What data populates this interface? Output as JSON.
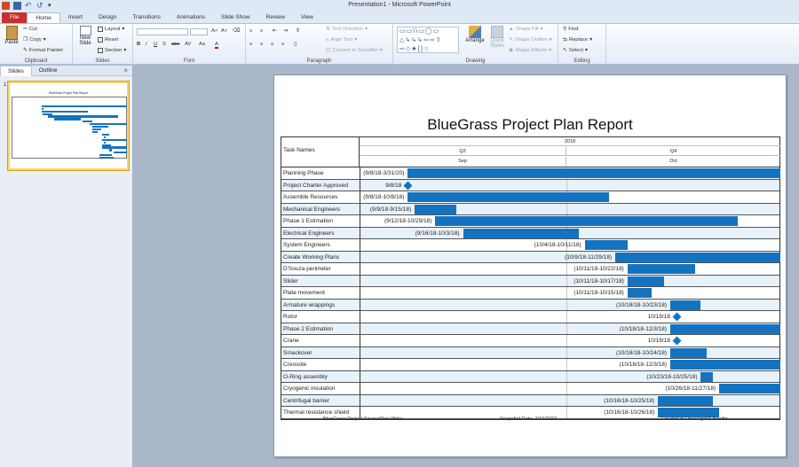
{
  "window": {
    "title": "Presentation1 - Microsoft PowerPoint"
  },
  "tabs": [
    "File",
    "Home",
    "Insert",
    "Design",
    "Transitions",
    "Animations",
    "Slide Show",
    "Review",
    "View"
  ],
  "ribbon": {
    "clipboard": {
      "label": "Clipboard",
      "paste": "Paste",
      "cut": "Cut",
      "copy": "Copy",
      "format_painter": "Format Painter"
    },
    "slides": {
      "label": "Slides",
      "new_slide": "New Slide",
      "layout": "Layout",
      "reset": "Reset",
      "section": "Section"
    },
    "font": {
      "label": "Font"
    },
    "paragraph": {
      "label": "Paragraph",
      "text_direction": "Text Direction",
      "align_text": "Align Text",
      "convert_smartart": "Convert to SmartArt"
    },
    "drawing": {
      "label": "Drawing",
      "arrange": "Arrange",
      "quick_styles": "Quick Styles",
      "shape_fill": "Shape Fill",
      "shape_outline": "Shape Outline",
      "shape_effects": "Shape Effects"
    },
    "editing": {
      "label": "Editing",
      "find": "Find",
      "replace": "Replace",
      "select": "Select"
    }
  },
  "left_panel": {
    "tab_slides": "Slides",
    "tab_outline": "Outline",
    "slide_number": "1"
  },
  "slide": {
    "title": "BlueGrass Project Plan Report",
    "header": {
      "task_names": "Task Names",
      "year": "2018",
      "q3": "Q3",
      "q4": "Q4",
      "sep": "Sep",
      "oct": "Oct"
    },
    "footer": {
      "left": "BlueGrass Project SourcePlan-Wrike",
      "center": "Snapshot Date: 2/10/2023",
      "right": "Created in OnePager® Bundle"
    }
  },
  "colors": {
    "bar": "#1473c0",
    "row_alt": "#e8f2fa",
    "file_tab": "#c9302c",
    "thumb_border": "#f7d66a"
  },
  "chart_data": {
    "type": "gantt",
    "timeline": {
      "start": "2018-09-01",
      "end": "2018-11-05",
      "quarter_boundary": "2018-10-01"
    },
    "tasks": [
      {
        "name": "Planning Phase",
        "label": "(9/8/18-3/31/20)",
        "start": "2018-09-08",
        "end": "2020-03-31",
        "milestone": false
      },
      {
        "name": "Project Charter Approved",
        "label": "9/8/18",
        "start": "2018-09-08",
        "end": "2018-09-08",
        "milestone": true
      },
      {
        "name": "Assemble Resources",
        "label": "(9/8/18-10/8/18)",
        "start": "2018-09-08",
        "end": "2018-10-08",
        "milestone": false
      },
      {
        "name": "Mechanical Engineers",
        "label": "(9/9/18-9/15/18)",
        "start": "2018-09-09",
        "end": "2018-09-15",
        "milestone": false
      },
      {
        "name": "Phase 1 Estimation",
        "label": "(9/12/18-10/29/18)",
        "start": "2018-09-12",
        "end": "2018-10-29",
        "milestone": false
      },
      {
        "name": "Electrical Engineers",
        "label": "(9/16/18-10/3/18)",
        "start": "2018-09-16",
        "end": "2018-10-03",
        "milestone": false
      },
      {
        "name": "System Engineers",
        "label": "(10/4/18-10/11/18)",
        "start": "2018-10-04",
        "end": "2018-10-11",
        "milestone": false
      },
      {
        "name": "Create Working Plans",
        "label": "(10/9/18-11/29/18)",
        "start": "2018-10-09",
        "end": "2018-11-29",
        "milestone": false
      },
      {
        "name": "D'Souza perimeter",
        "label": "(10/11/18-10/22/18)",
        "start": "2018-10-11",
        "end": "2018-10-22",
        "milestone": false
      },
      {
        "name": "Slider",
        "label": "(10/11/18-10/17/18)",
        "start": "2018-10-11",
        "end": "2018-10-17",
        "milestone": false
      },
      {
        "name": "Plate movement",
        "label": "(10/11/18-10/15/18)",
        "start": "2018-10-11",
        "end": "2018-10-15",
        "milestone": false
      },
      {
        "name": "Armature wrappings",
        "label": "(10/18/18-10/23/18)",
        "start": "2018-10-18",
        "end": "2018-10-23",
        "milestone": false
      },
      {
        "name": "Rotor",
        "label": "10/19/18",
        "start": "2018-10-19",
        "end": "2018-10-19",
        "milestone": true
      },
      {
        "name": "Phase 2 Estimation",
        "label": "(10/18/18-12/3/18)",
        "start": "2018-10-18",
        "end": "2018-12-03",
        "milestone": false
      },
      {
        "name": "Crane",
        "label": "10/19/18",
        "start": "2018-10-19",
        "end": "2018-10-19",
        "milestone": true
      },
      {
        "name": "Smackover",
        "label": "(10/18/18-10/24/18)",
        "start": "2018-10-18",
        "end": "2018-10-24",
        "milestone": false
      },
      {
        "name": "Creosote",
        "label": "(10/18/18-12/3/18)",
        "start": "2018-10-18",
        "end": "2018-12-03",
        "milestone": false
      },
      {
        "name": "O-Ring assembly",
        "label": "(10/23/18-10/25/18)",
        "start": "2018-10-23",
        "end": "2018-10-25",
        "milestone": false
      },
      {
        "name": "Cryogenic insulation",
        "label": "(10/26/18-11/27/18)",
        "start": "2018-10-26",
        "end": "2018-11-27",
        "milestone": false
      },
      {
        "name": "Centrifugal barrier",
        "label": "(10/16/18-10/25/18)",
        "start": "2018-10-16",
        "end": "2018-10-25",
        "milestone": false
      },
      {
        "name": "Thermal resistance shield",
        "label": "(10/16/18-10/26/18)",
        "start": "2018-10-16",
        "end": "2018-10-26",
        "milestone": false
      }
    ]
  }
}
